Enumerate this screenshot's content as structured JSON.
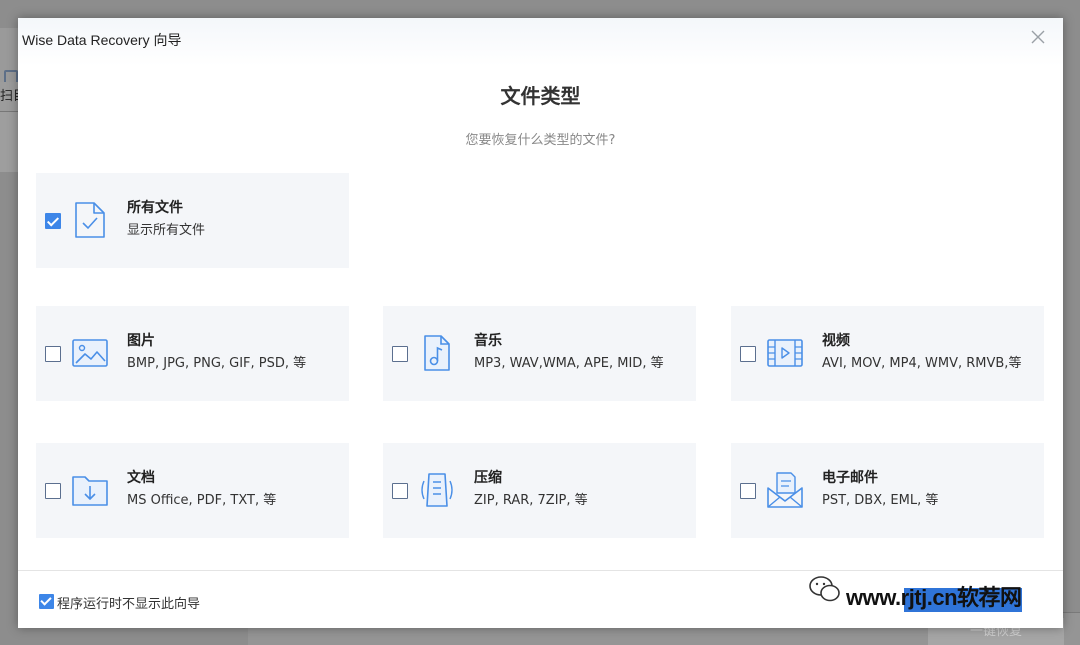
{
  "window": {
    "title": "Wise Data Recovery 向导"
  },
  "background": {
    "tab_label": "扫目",
    "bottom_button": "一键恢复"
  },
  "dialog": {
    "heading": "文件类型",
    "subheading": "您要恢复什么类型的文件?",
    "cards": {
      "all": {
        "title": "所有文件",
        "desc": "显示所有文件",
        "checked": true,
        "icon": "file-check-icon"
      },
      "images": {
        "title": "图片",
        "desc": "BMP, JPG, PNG, GIF, PSD, 等",
        "checked": false,
        "icon": "image-icon"
      },
      "music": {
        "title": "音乐",
        "desc": "MP3, WAV,WMA, APE, MID, 等",
        "checked": false,
        "icon": "music-file-icon"
      },
      "video": {
        "title": "视频",
        "desc": "AVI, MOV, MP4, WMV, RMVB,等",
        "checked": false,
        "icon": "video-icon"
      },
      "docs": {
        "title": "文档",
        "desc": "MS Office, PDF, TXT, 等",
        "checked": false,
        "icon": "folder-download-icon"
      },
      "archives": {
        "title": "压缩",
        "desc": "ZIP, RAR, 7ZIP, 等",
        "checked": false,
        "icon": "archive-icon"
      },
      "email": {
        "title": "电子邮件",
        "desc": "PST, DBX, EML, 等",
        "checked": false,
        "icon": "mail-icon"
      }
    },
    "footer": {
      "dont_show_label": "程序运行时不显示此向导",
      "dont_show_checked": true
    }
  },
  "watermark": {
    "text": "www.rjtj.cn软荐网"
  },
  "colors": {
    "accent": "#3d86e8",
    "icon_stroke": "#4a8fe7",
    "card_bg": "#f4f6f9"
  }
}
